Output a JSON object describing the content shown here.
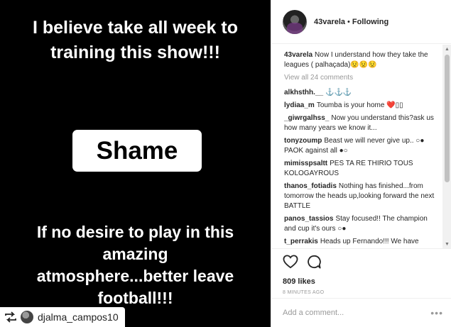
{
  "story": {
    "top_lines": [
      "I believe take all week to",
      "training this show!!!"
    ],
    "shame": "Shame",
    "bottom_lines": [
      "If no desire to play in this",
      "amazing",
      "atmosphere...better leave",
      "football!!!"
    ],
    "repost_user": "djalma_campos10"
  },
  "post": {
    "username": "43varela",
    "separator": "•",
    "follow_status": "Following",
    "caption_user": "43varela",
    "caption_text": "Now I understand how they take the leagues ( palhaçada)😟😟😟",
    "view_all": "View all 24 comments",
    "comments": [
      {
        "user": "alkhsthh.__",
        "text": "⚓⚓⚓"
      },
      {
        "user": "lydiaa_m",
        "text": "Toumba is your home ❤️▯▯"
      },
      {
        "user": "_giwrgalhss_",
        "text": "Now you understand this?ask us how many years we know it..."
      },
      {
        "user": "tonyzoump",
        "text": "Beast we will never give up.. ○● PAOK against all ●○"
      },
      {
        "user": "mimisspsaltt",
        "text": "PES TA RE THIRIO TOUS KOLOGAYROUS"
      },
      {
        "user": "thanos_fotiadis",
        "text": "Nothing has finished...from tomorrow the heads up,looking forward the next BATTLE"
      },
      {
        "user": "panos_tassios",
        "text": "Stay focused!! The champion and cup it's ours ○●"
      },
      {
        "user": "t_perrakis",
        "text": "Heads up Fernando!!! We have"
      }
    ],
    "likes": "809 likes",
    "time": "8 MINUTES AGO",
    "add_comment_placeholder": "Add a comment...",
    "more_label": "•••"
  }
}
